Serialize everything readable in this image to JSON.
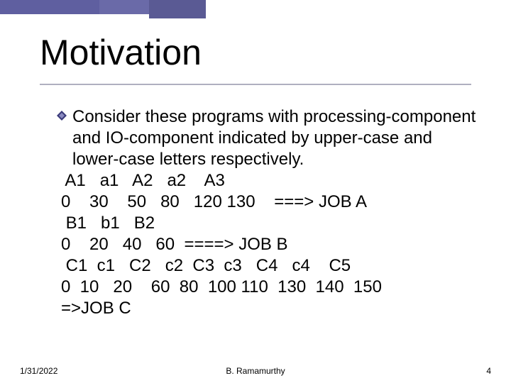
{
  "title": "Motivation",
  "bullet_text": "Consider these programs with processing-component and IO-component indicated by upper-case and lower-case letters respectively.",
  "lines": {
    "l1": " A1   a1   A2   a2    A3",
    "l2": "0    30    50   80   120 130    ===> JOB A",
    "l3": " B1   b1   B2",
    "l4": "0    20   40   60  ====> JOB B",
    "l5": " C1  c1   C2   c2  C3  c3   C4   c4    C5",
    "l6": "0  10   20    60  80  100 110  130  140  150",
    "l7": "=>JOB C"
  },
  "footer": {
    "date": "1/31/2022",
    "author": "B. Ramamurthy",
    "page": "4"
  }
}
